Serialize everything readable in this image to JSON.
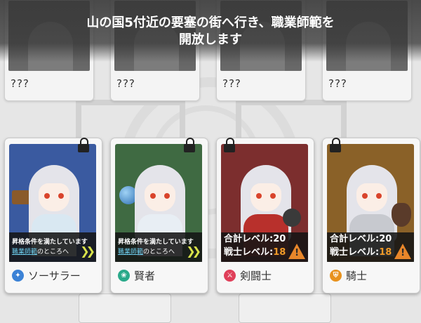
{
  "banner": {
    "line1": "山の国5付近の要塞の街へ行き、職業師範を",
    "line2": "開放します"
  },
  "locked_top_cards": [
    {
      "label": "???"
    },
    {
      "label": "???"
    },
    {
      "label": "???"
    },
    {
      "label": "???"
    }
  ],
  "class_cards": [
    {
      "name": "ソーサラー",
      "icon": "sorcerer-icon",
      "icon_color": "#3b82d6",
      "bg_color": "#3a5aa0",
      "requirement": {
        "line1": "昇格条件を満たしています",
        "link": "職業師範",
        "suffix": "のところへ"
      }
    },
    {
      "name": "賢者",
      "icon": "sage-icon",
      "icon_color": "#2aa98a",
      "bg_color": "#3f6a42",
      "requirement": {
        "line1": "昇格条件を満たしています",
        "link": "職業師範",
        "suffix": "のところへ"
      }
    },
    {
      "name": "剣闘士",
      "icon": "gladiator-icon",
      "icon_color": "#e0405a",
      "bg_color": "#7c2e2e",
      "levels": {
        "total": "合計レベル:20",
        "warrior_label": "戦士レベル:",
        "warrior_value": "18"
      }
    },
    {
      "name": "騎士",
      "icon": "knight-icon",
      "icon_color": "#e8921e",
      "bg_color": "#8a6128",
      "levels": {
        "total": "合計レベル:20",
        "warrior_label": "戦士レベル:",
        "warrior_value": "18"
      }
    }
  ]
}
